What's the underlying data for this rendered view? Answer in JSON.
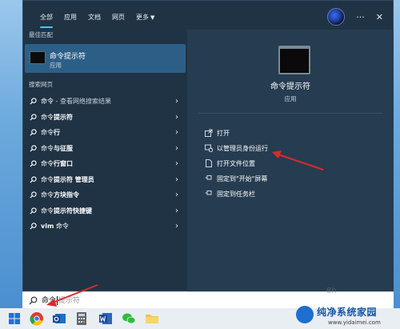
{
  "nav": {
    "tabs": [
      "全部",
      "应用",
      "文档",
      "网页",
      "更多"
    ]
  },
  "left": {
    "best_match_title": "最佳匹配",
    "best_match": {
      "title": "命令提示符",
      "subtitle": "应用"
    },
    "web_title": "搜索网页",
    "results": [
      {
        "pre": "命令",
        "bold": "",
        "post": " - 查看网络搜索结果"
      },
      {
        "pre": "命令",
        "bold": "提示符",
        "post": ""
      },
      {
        "pre": "命令",
        "bold": "行",
        "post": ""
      },
      {
        "pre": "命令",
        "bold": "与征服",
        "post": ""
      },
      {
        "pre": "命令",
        "bold": "行窗口",
        "post": ""
      },
      {
        "pre": "命令",
        "bold": "提示符 管理员",
        "post": ""
      },
      {
        "pre": "命令",
        "bold": "方块指令",
        "post": ""
      },
      {
        "pre": "命令",
        "bold": "提示符快捷键",
        "post": ""
      },
      {
        "pre": "",
        "bold": "vim",
        "post": " 命令"
      }
    ]
  },
  "right": {
    "title": "命令提示符",
    "subtitle": "应用",
    "actions": [
      "打开",
      "以管理员身份运行",
      "打开文件位置",
      "固定到\"开始\"屏幕",
      "固定到任务栏"
    ]
  },
  "search": {
    "typed": "命令",
    "ghost": "提示符"
  },
  "watermark": {
    "name": "纯净系统家园",
    "url": "www.yidaimei.com",
    "sign": "8h"
  },
  "colors": {
    "panel": "#1f3345",
    "selected": "#2d5f86",
    "accent": "#4cc2ff",
    "annotation_arrow": "#d92b2b"
  }
}
